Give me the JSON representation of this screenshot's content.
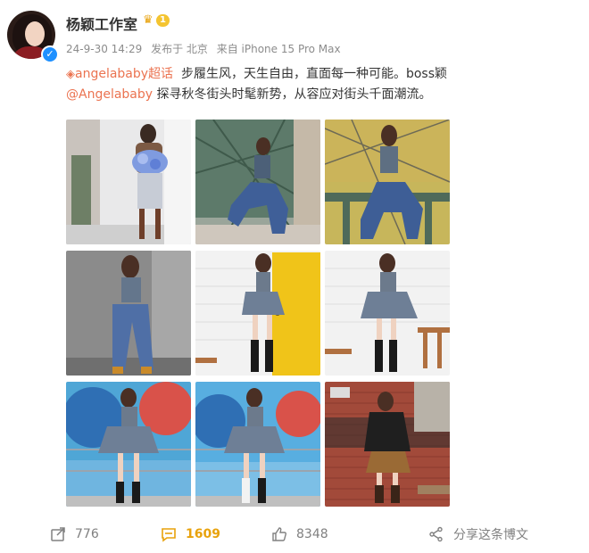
{
  "author": {
    "name": "杨颖工作室",
    "vip_level": "1"
  },
  "meta": {
    "timestamp": "24-9-30 14:29",
    "location": "发布于 北京",
    "source": "来自 iPhone 15 Pro Max"
  },
  "post": {
    "topic": "angelababy超话",
    "text_line1": "步履生风，天生自由，直面每一种可能。boss颖",
    "mention": "@Angelababy",
    "text_line2": "探寻秋冬街头时髦新势，从容应对街头千面潮流。"
  },
  "photos": [
    {
      "name": "photo-1",
      "scene": "white-wall-bouquet"
    },
    {
      "name": "photo-2",
      "scene": "green-fence-denim"
    },
    {
      "name": "photo-3",
      "scene": "fence-sitting-denim"
    },
    {
      "name": "photo-4",
      "scene": "grey-wall-jeans"
    },
    {
      "name": "photo-5",
      "scene": "yellow-door-skirt"
    },
    {
      "name": "photo-6",
      "scene": "bench-skirt"
    },
    {
      "name": "photo-7",
      "scene": "mural-skirt"
    },
    {
      "name": "photo-8",
      "scene": "mural-skirt-2"
    },
    {
      "name": "photo-9",
      "scene": "brick-leather-jacket"
    }
  ],
  "actions": {
    "repost_count": "776",
    "comment_count": "1609",
    "like_count": "8348",
    "share_label": "分享这条博文"
  },
  "colors": {
    "accent": "#eb7350",
    "comment_highlight": "#e8a20c",
    "meta_text": "#8c8c8c"
  }
}
